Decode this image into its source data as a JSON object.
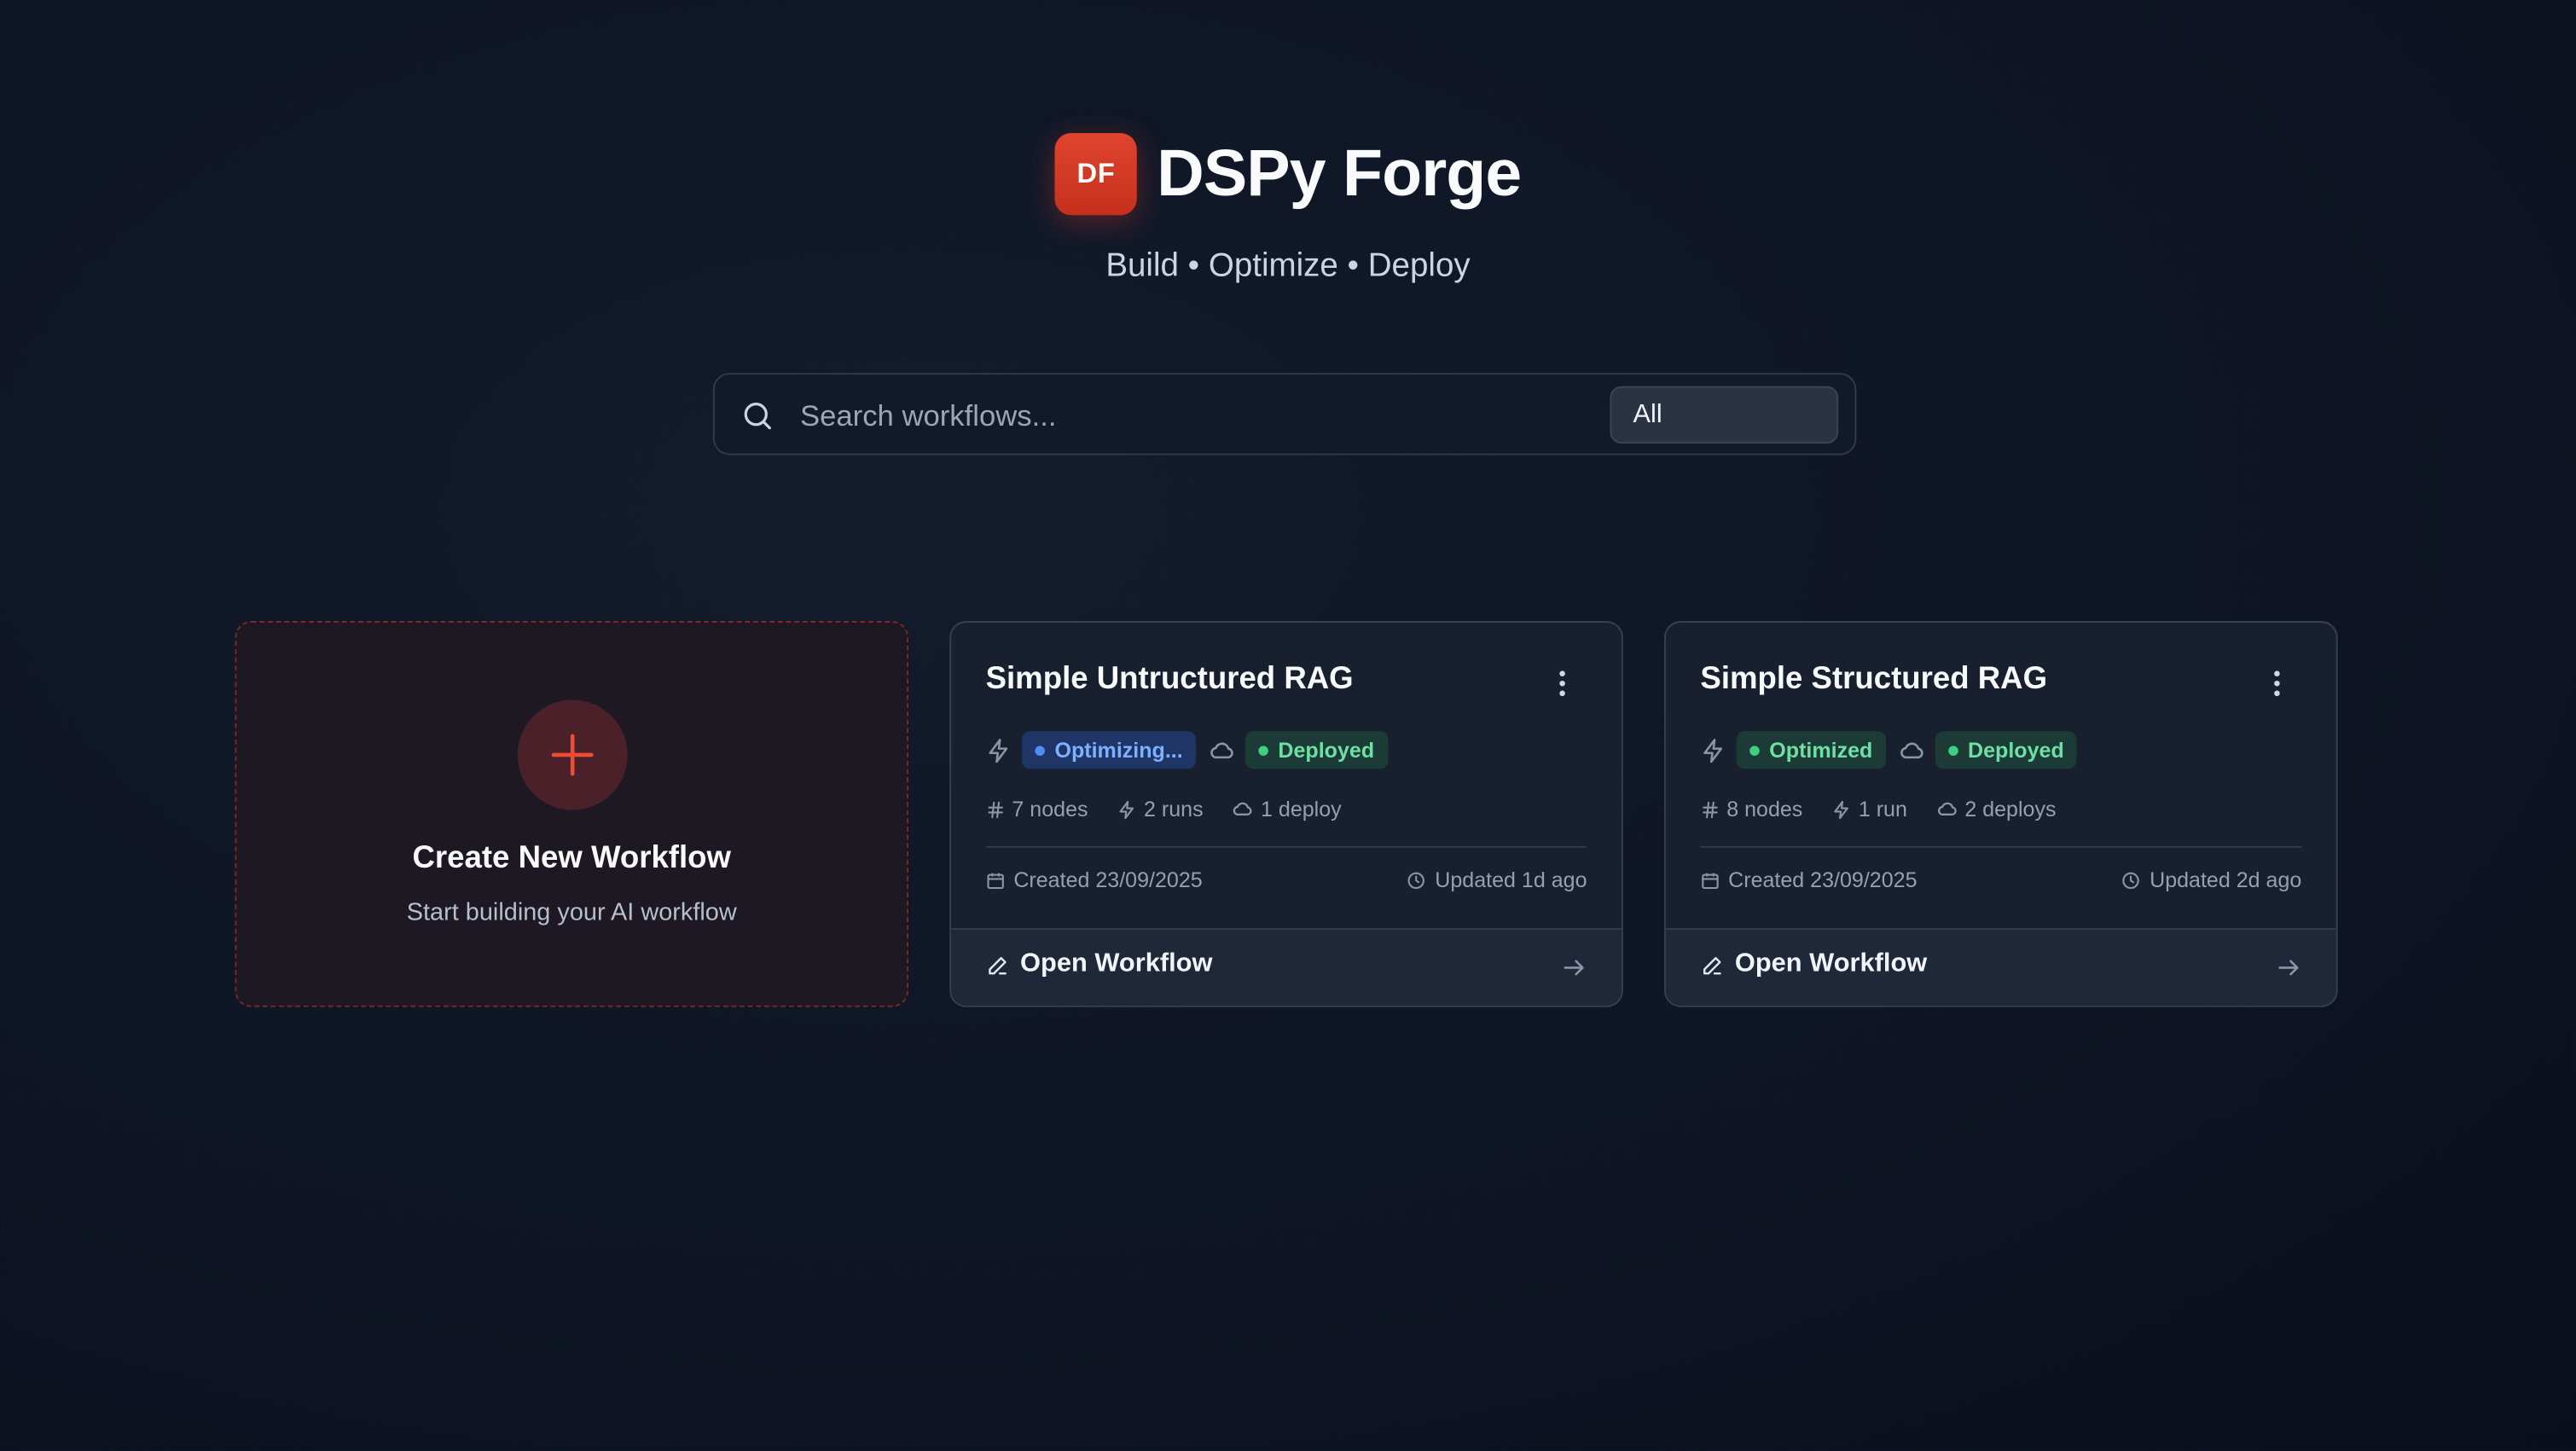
{
  "app": {
    "logo_text": "DF",
    "title": "DSPy Forge",
    "tagline": "Build • Optimize • Deploy"
  },
  "search": {
    "placeholder": "Search workflows...",
    "value": "",
    "filter_selected": "All"
  },
  "create_card": {
    "title": "Create New Workflow",
    "subtitle": "Start building your AI workflow"
  },
  "workflows": [
    {
      "title": "Simple Untructured RAG",
      "optimize_status": "Optimizing...",
      "optimize_color": "blue",
      "deploy_status": "Deployed",
      "nodes": "7 nodes",
      "runs": "2 runs",
      "deploys": "1 deploy",
      "created": "Created 23/09/2025",
      "updated": "Updated 1d ago",
      "open_label": "Open Workflow"
    },
    {
      "title": "Simple Structured RAG",
      "optimize_status": "Optimized",
      "optimize_color": "green",
      "deploy_status": "Deployed",
      "nodes": "8 nodes",
      "runs": "1 run",
      "deploys": "2 deploys",
      "created": "Created 23/09/2025",
      "updated": "Updated 2d ago",
      "open_label": "Open Workflow"
    }
  ],
  "colors": {
    "brand": "#d9392a",
    "background": "#0f1626",
    "card": "#182030",
    "status_blue": "#4f8df5",
    "status_green": "#3fcf83"
  },
  "icons": [
    "search-icon",
    "plus-icon",
    "bolt-icon",
    "cloud-icon",
    "hash-icon",
    "calendar-icon",
    "clock-icon",
    "pencil-icon",
    "arrow-right-icon",
    "more-vertical-icon"
  ]
}
